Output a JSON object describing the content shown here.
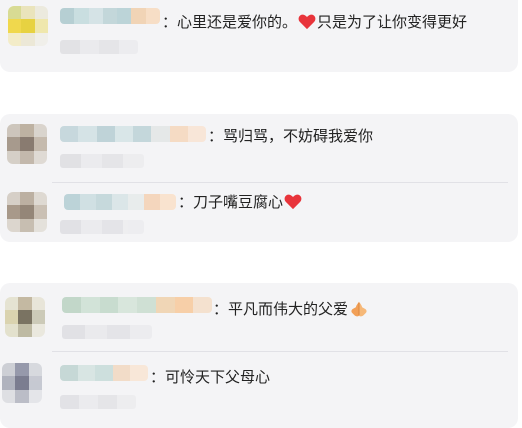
{
  "comments": [
    {
      "text_before": "：心里还是爱你的。",
      "icon": "heart-icon",
      "text_after": "只是为了让你变得更好"
    },
    {
      "text": "：骂归骂，不妨碍我爱你"
    },
    {
      "text_before": "：刀子嘴豆腐心",
      "icon": "heart-icon",
      "text_after": ""
    },
    {
      "text_before": "：平凡而伟大的父爱",
      "icon": "folded-hands-icon",
      "text_after": ""
    },
    {
      "text": "：可怜天下父母心"
    }
  ],
  "colors": {
    "card_bg": "#f4f4f6",
    "heart": "#e8343b",
    "hands": "#f2a057",
    "text": "#222222"
  }
}
